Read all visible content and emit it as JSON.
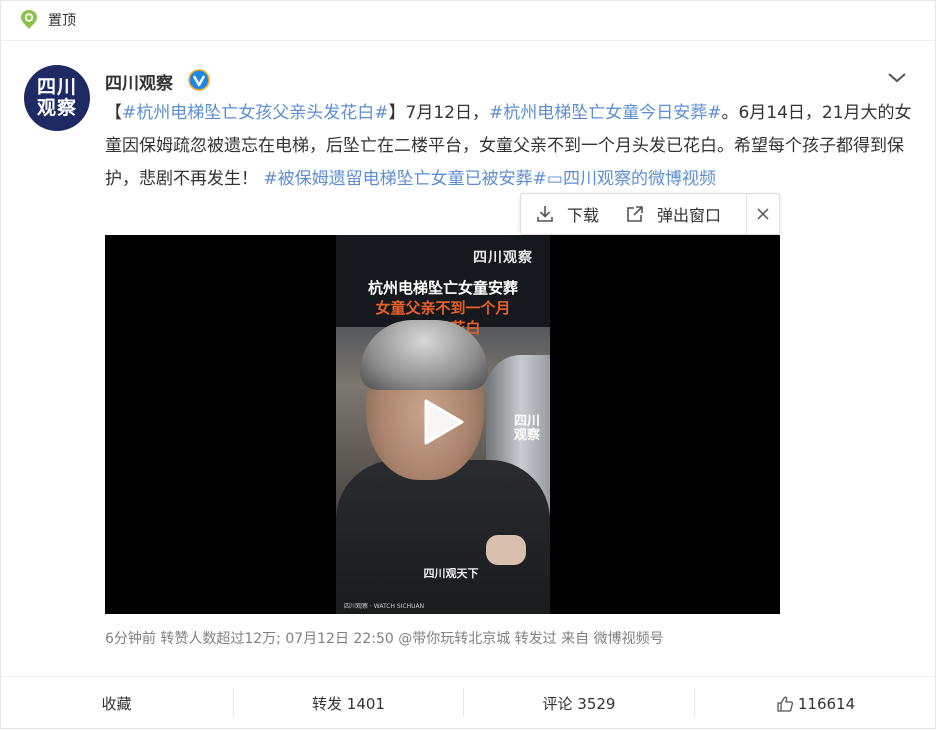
{
  "pin": {
    "label": "置顶",
    "icon": "pin-icon"
  },
  "author": {
    "name": "四川观察",
    "avatar_text": [
      "四川",
      "观察"
    ],
    "verified_icon": "verified-icon"
  },
  "post": {
    "segments": [
      {
        "text": "【",
        "tag": false
      },
      {
        "text": "#杭州电梯坠亡女孩父亲头发花白#",
        "tag": true
      },
      {
        "text": "】7月12日，",
        "tag": false
      },
      {
        "text": "#杭州电梯坠亡女童今日安葬#",
        "tag": true
      },
      {
        "text": "。6月14日，21月大的女童因保姆疏忽被遗忘在电梯，后坠亡在二楼平台，女童父亲不到一个月头发已花白。希望每个孩子都得到保护，悲剧不再发生！ ",
        "tag": false
      },
      {
        "text": "#被保姆遗留电梯坠亡女童已被安葬#",
        "tag": true
      },
      {
        "text": "▭四川观察的微博视频",
        "tag": true
      }
    ]
  },
  "popup": {
    "download_label": "下载",
    "popout_label": "弹出窗口"
  },
  "video": {
    "logo": "四川观察",
    "overlay_title": "杭州电梯坠亡女童安葬",
    "overlay_line2": "女童父亲不到一个月",
    "overlay_line3": "头发已花白",
    "side_logo": "四川观察",
    "bottom_logo": "四川观天下",
    "bottom_sub": "四川观察 · WATCH SICHUAN"
  },
  "meta": {
    "text": "6分钟前 转赞人数超过12万; 07月12日 22:50 @带你玩转北京城 转发过  来自 微博视频号"
  },
  "actions": {
    "collect_label": "收藏",
    "repost_label": "转发 1401",
    "comment_label": "评论 3529",
    "like_count": "116614"
  },
  "colors": {
    "tag": "#5d8ed1",
    "pin_green": "#8bc34a",
    "verified_blue": "#1e88e5",
    "overlay_orange": "#e6602a"
  }
}
